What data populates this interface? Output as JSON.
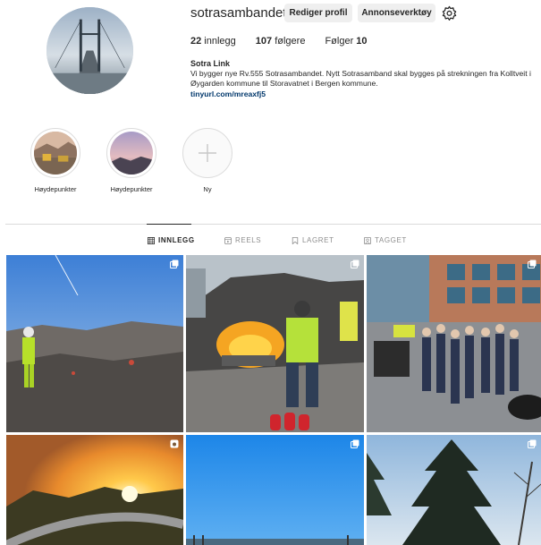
{
  "profile": {
    "username": "sotrasambandet",
    "edit_profile_label": "Rediger profil",
    "ad_tools_label": "Annonseverktøy",
    "stats": {
      "posts_count": "22",
      "posts_label": " innlegg",
      "followers_count": "107",
      "followers_label": " følgere",
      "following_label": "Følger ",
      "following_count": "10"
    },
    "bio": {
      "name": "Sotra Link",
      "text": "Vi bygger nye Rv.555 Sotrasambandet. Nytt Sotrasamband skal bygges på strekningen fra Kolltveit i Øygarden kommune til Storavatnet i Bergen kommune.",
      "link": "tinyurl.com/mreaxfj5"
    }
  },
  "highlights": [
    {
      "label": "Høydepunkter"
    },
    {
      "label": "Høydepunkter"
    },
    {
      "label": "Ny"
    }
  ],
  "tabs": [
    {
      "label": "INNLEGG",
      "active": true
    },
    {
      "label": "REELS",
      "active": false
    },
    {
      "label": "LAGRET",
      "active": false
    },
    {
      "label": "TAGGET",
      "active": false
    }
  ],
  "colors": {
    "text": "#262626",
    "link": "#00376b",
    "muted": "#8e8e8e",
    "button_bg": "#efefef",
    "divider": "#dbdbdb"
  }
}
